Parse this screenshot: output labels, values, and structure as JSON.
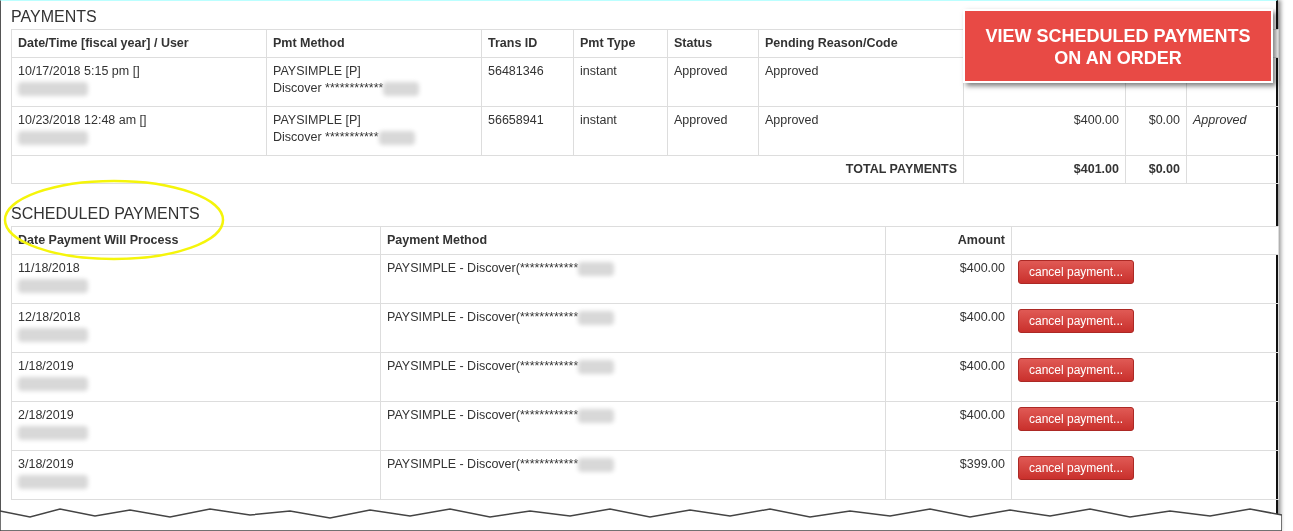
{
  "payments": {
    "title": "PAYMENTS",
    "columns": [
      "Date/Time [fiscal year] / User",
      "Pmt Method",
      "Trans ID",
      "Pmt Type",
      "Status",
      "Pending Reason/Code"
    ],
    "rows": [
      {
        "date_time": "10/17/2018 5:15 pm []",
        "method": "PAYSIMPLE [P]",
        "card": "Discover ************",
        "trans_id": "56481346",
        "type": "instant",
        "status": "Approved",
        "reason": "Approved"
      },
      {
        "date_time": "10/23/2018 12:48 am []",
        "method": "PAYSIMPLE [P]",
        "card": "Discover ***********",
        "trans_id": "56658941",
        "type": "instant",
        "status": "Approved",
        "reason": "Approved",
        "amount": "$400.00",
        "column_8": "$0.00",
        "column_9": "Approved"
      }
    ],
    "total": {
      "label": "TOTAL PAYMENTS",
      "amount": "$401.00",
      "column_8": "$0.00"
    }
  },
  "scheduled": {
    "title": "SCHEDULED PAYMENTS",
    "columns": [
      "Date Payment Will Process",
      "Payment Method",
      "Amount"
    ],
    "rows": [
      {
        "date": "11/18/2018",
        "method": "PAYSIMPLE - Discover(************",
        "amount": "$400.00",
        "action": "cancel payment..."
      },
      {
        "date": "12/18/2018",
        "method": "PAYSIMPLE - Discover(************",
        "amount": "$400.00",
        "action": "cancel payment..."
      },
      {
        "date": "1/18/2019",
        "method": "PAYSIMPLE - Discover(************",
        "amount": "$400.00",
        "action": "cancel payment..."
      },
      {
        "date": "2/18/2019",
        "method": "PAYSIMPLE - Discover(************",
        "amount": "$400.00",
        "action": "cancel payment..."
      },
      {
        "date": "3/18/2019",
        "method": "PAYSIMPLE - Discover(************",
        "amount": "$399.00",
        "action": "cancel payment..."
      }
    ]
  },
  "callout": {
    "lines": [
      "VIEW SCHEDULED PAYMENTS",
      "ON AN ORDER"
    ]
  }
}
